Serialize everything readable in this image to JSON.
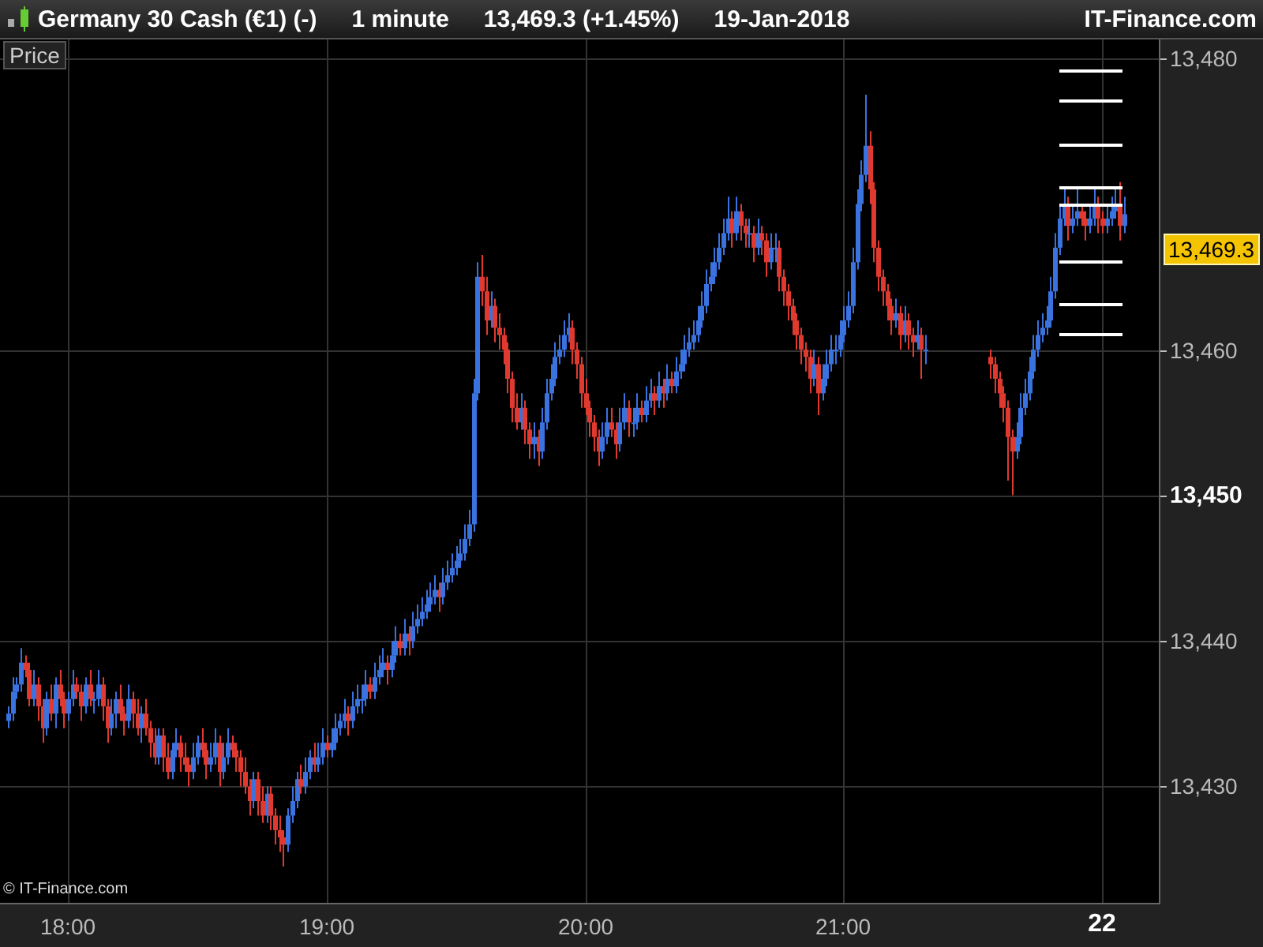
{
  "header": {
    "instrument": "Germany 30 Cash (€1) (-)",
    "interval": "1 minute",
    "quote": "13,469.3 (+1.45%)",
    "date": "19-Jan-2018",
    "brand": "IT-Finance.com"
  },
  "chart": {
    "series_label": "Price",
    "credit": "© IT-Finance.com",
    "last_price": "13,469.3",
    "tick_emphasis": {
      "x": [
        false,
        false,
        false,
        false,
        true
      ],
      "y": [
        false,
        false,
        true,
        false,
        false
      ]
    },
    "chart_data": {
      "type": "candlestick",
      "grid": true,
      "xlim": [
        17.7375,
        22.225
      ],
      "ylim": [
        13421.9,
        13481.3
      ],
      "xticks": [
        {
          "value": 18,
          "label": "18:00"
        },
        {
          "value": 19,
          "label": "19:00"
        },
        {
          "value": 20,
          "label": "20:00"
        },
        {
          "value": 21,
          "label": "21:00"
        },
        {
          "value": 22,
          "label": "22"
        }
      ],
      "yticks": [
        {
          "value": 13480,
          "label": "13,480"
        },
        {
          "value": 13460,
          "label": "13,460"
        },
        {
          "value": 13450,
          "label": "13,450"
        },
        {
          "value": 13440,
          "label": "13,440"
        },
        {
          "value": 13430,
          "label": "13,430"
        }
      ],
      "x": [
        17.7667,
        17.7833,
        17.8,
        17.8167,
        17.8333,
        17.85,
        17.8667,
        17.8833,
        17.9,
        17.9167,
        17.9333,
        17.95,
        17.9667,
        17.9833,
        18,
        18.0167,
        18.0333,
        18.05,
        18.0667,
        18.0833,
        18.1,
        18.1167,
        18.1333,
        18.15,
        18.1667,
        18.1833,
        18.2,
        18.2167,
        18.2333,
        18.25,
        18.2667,
        18.2833,
        18.3,
        18.3167,
        18.3333,
        18.35,
        18.3667,
        18.3833,
        18.4,
        18.4167,
        18.4333,
        18.45,
        18.4667,
        18.4833,
        18.5,
        18.5167,
        18.5333,
        18.55,
        18.5667,
        18.5833,
        18.6,
        18.6167,
        18.6333,
        18.65,
        18.6667,
        18.6833,
        18.7,
        18.7167,
        18.7333,
        18.75,
        18.7667,
        18.7833,
        18.8,
        18.8167,
        18.8333,
        18.85,
        18.8667,
        18.8833,
        18.9,
        18.9167,
        18.9333,
        18.95,
        18.9667,
        18.9833,
        19,
        19.0167,
        19.0333,
        19.05,
        19.0667,
        19.0833,
        19.1,
        19.1167,
        19.1333,
        19.15,
        19.1667,
        19.1833,
        19.2,
        19.2167,
        19.2333,
        19.25,
        19.2667,
        19.2833,
        19.3,
        19.3167,
        19.3333,
        19.35,
        19.3667,
        19.3833,
        19.4,
        19.4167,
        19.4333,
        19.45,
        19.4667,
        19.4833,
        19.5,
        19.5167,
        19.5333,
        19.55,
        19.5667,
        19.5833,
        19.6,
        19.6167,
        19.6333,
        19.65,
        19.6667,
        19.6833,
        19.7,
        19.7167,
        19.7333,
        19.75,
        19.7667,
        19.7833,
        19.8,
        19.8167,
        19.8333,
        19.85,
        19.8667,
        19.8833,
        19.9,
        19.9167,
        19.9333,
        19.95,
        19.9667,
        19.9833,
        20,
        20.0167,
        20.0333,
        20.05,
        20.0667,
        20.0833,
        20.1,
        20.1167,
        20.1333,
        20.15,
        20.1667,
        20.1833,
        20.2,
        20.2167,
        20.2333,
        20.25,
        20.2667,
        20.2833,
        20.3,
        20.3167,
        20.3333,
        20.35,
        20.3667,
        20.3833,
        20.4,
        20.4167,
        20.4333,
        20.45,
        20.4667,
        20.4833,
        20.5,
        20.5167,
        20.5333,
        20.55,
        20.5667,
        20.5833,
        20.6,
        20.6167,
        20.6333,
        20.65,
        20.6667,
        20.6833,
        20.7,
        20.7167,
        20.7333,
        20.75,
        20.7667,
        20.7833,
        20.8,
        20.8167,
        20.8333,
        20.85,
        20.8667,
        20.8833,
        20.9,
        20.9167,
        20.9333,
        20.95,
        20.9667,
        20.9833,
        21,
        21.0167,
        21.0333,
        21.05,
        21.0667,
        21.0833,
        21.1,
        21.1167,
        21.1333,
        21.15,
        21.1667,
        21.1833,
        21.2,
        21.2167,
        21.2333,
        21.25,
        21.2667,
        21.2833,
        21.3,
        21.3167,
        21.5667,
        21.5833,
        21.6,
        21.6167,
        21.6333,
        21.65,
        21.6667,
        21.6833,
        21.7,
        21.7167,
        21.7333,
        21.75,
        21.7667,
        21.7833,
        21.8,
        21.8167,
        21.8333,
        21.85,
        21.8667,
        21.8833,
        21.9,
        21.9167,
        21.9333,
        21.95,
        21.9667,
        21.9833,
        22,
        22.0167,
        22.0333,
        22.05,
        22.0667,
        22.0833
      ],
      "ohlc": [
        [
          13434.5,
          13435.5,
          13434,
          13435
        ],
        [
          13435,
          13437.5,
          13434.5,
          13436.5
        ],
        [
          13436.5,
          13437.5,
          13436,
          13437
        ],
        [
          13437,
          13439.5,
          13436.5,
          13438.5
        ],
        [
          13438.5,
          13439,
          13437.5,
          13438
        ],
        [
          13438,
          13438.5,
          13435.5,
          13436
        ],
        [
          13436,
          13438,
          13435.5,
          13437
        ],
        [
          13437,
          13437.5,
          13434.5,
          13435.5
        ],
        [
          13435.5,
          13436,
          13433,
          13434
        ],
        [
          13434,
          13436.5,
          13433.5,
          13436
        ],
        [
          13436,
          13437,
          13434.5,
          13435
        ],
        [
          13435,
          13437.5,
          13434,
          13437
        ],
        [
          13437,
          13438,
          13435.5,
          13436
        ],
        [
          13436,
          13436.5,
          13434,
          13435
        ],
        [
          13435,
          13436.5,
          13434.5,
          13436
        ],
        [
          13436,
          13438,
          13435.5,
          13437
        ],
        [
          13437,
          13437.5,
          13436,
          13436.5
        ],
        [
          13436.5,
          13437,
          13434.5,
          13435.5
        ],
        [
          13435.5,
          13437.5,
          13435,
          13437
        ],
        [
          13437,
          13438,
          13435.5,
          13436
        ],
        [
          13436,
          13436.5,
          13435,
          13436
        ],
        [
          13436,
          13438,
          13435.5,
          13437
        ],
        [
          13437,
          13437.5,
          13434.5,
          13435.5
        ],
        [
          13435.5,
          13436,
          13433,
          13434
        ],
        [
          13434,
          13436,
          13433.5,
          13435
        ],
        [
          13435,
          13436.5,
          13434,
          13436
        ],
        [
          13436,
          13437,
          13434.5,
          13435
        ],
        [
          13435,
          13435.5,
          13433.5,
          13434.5
        ],
        [
          13434.5,
          13437,
          13434,
          13436
        ],
        [
          13436,
          13436.5,
          13434,
          13435
        ],
        [
          13435,
          13436,
          13433.5,
          13434
        ],
        [
          13434,
          13435.5,
          13433,
          13435
        ],
        [
          13435,
          13436,
          13433.5,
          13434
        ],
        [
          13434,
          13434.5,
          13432,
          13433
        ],
        [
          13433,
          13434,
          13431.5,
          13432
        ],
        [
          13432,
          13434,
          13431.5,
          13433.5
        ],
        [
          13433.5,
          13434,
          13431,
          13432
        ],
        [
          13432,
          13433,
          13430.5,
          13431
        ],
        [
          13431,
          13433,
          13430.5,
          13432.5
        ],
        [
          13432.5,
          13434,
          13432,
          13433
        ],
        [
          13433,
          13433.5,
          13431,
          13432
        ],
        [
          13432,
          13433,
          13431,
          13431.5
        ],
        [
          13431.5,
          13432,
          13430,
          13431
        ],
        [
          13431,
          13433,
          13430.5,
          13432
        ],
        [
          13432,
          13433.5,
          13431.5,
          13433
        ],
        [
          13433,
          13434,
          13432,
          13432.5
        ],
        [
          13432.5,
          13433,
          13430.5,
          13431.5
        ],
        [
          13431.5,
          13433,
          13431,
          13432
        ],
        [
          13432,
          13434,
          13431.5,
          13433
        ],
        [
          13433,
          13433.5,
          13430,
          13431
        ],
        [
          13431,
          13433,
          13430.5,
          13432
        ],
        [
          13432,
          13434,
          13431.5,
          13433
        ],
        [
          13433,
          13433.5,
          13432,
          13432.5
        ],
        [
          13432.5,
          13433,
          13431,
          13432
        ],
        [
          13432,
          13432.5,
          13430,
          13431
        ],
        [
          13431,
          13432,
          13429.5,
          13430
        ],
        [
          13430,
          13430.5,
          13428,
          13429
        ],
        [
          13429,
          13431,
          13428.5,
          13430.5
        ],
        [
          13430.5,
          13431,
          13428,
          13429
        ],
        [
          13429,
          13430,
          13427.5,
          13428
        ],
        [
          13428,
          13430,
          13427.5,
          13429.5
        ],
        [
          13429.5,
          13430,
          13427,
          13428
        ],
        [
          13428,
          13428.5,
          13426,
          13427
        ],
        [
          13427,
          13428,
          13425.5,
          13426.5
        ],
        [
          13426.5,
          13427,
          13424.5,
          13426
        ],
        [
          13426,
          13428.5,
          13425.5,
          13428
        ],
        [
          13428,
          13430,
          13427.5,
          13429
        ],
        [
          13429,
          13431,
          13428.5,
          13430.5
        ],
        [
          13430.5,
          13431.5,
          13429.5,
          13430
        ],
        [
          13430,
          13432,
          13429.5,
          13431
        ],
        [
          13431,
          13432.5,
          13430.5,
          13432
        ],
        [
          13432,
          13433,
          13431,
          13431.5
        ],
        [
          13431.5,
          13433,
          13431,
          13432
        ],
        [
          13432,
          13434,
          13431.5,
          13433
        ],
        [
          13433,
          13433.5,
          13432,
          13432.5
        ],
        [
          13432.5,
          13434,
          13432,
          13433
        ],
        [
          13433,
          13435,
          13432.5,
          13434
        ],
        [
          13434,
          13435,
          13433.5,
          13434.5
        ],
        [
          13434.5,
          13436,
          13434,
          13435
        ],
        [
          13435,
          13435.5,
          13433.5,
          13434.5
        ],
        [
          13434.5,
          13436.5,
          13434,
          13435.5
        ],
        [
          13435.5,
          13437,
          13435,
          13436
        ],
        [
          13436,
          13437,
          13435,
          13436
        ],
        [
          13436,
          13438,
          13435.5,
          13437
        ],
        [
          13437,
          13437.5,
          13436,
          13436.5
        ],
        [
          13436.5,
          13438.5,
          13436,
          13437.5
        ],
        [
          13437.5,
          13439,
          13437,
          13438
        ],
        [
          13438,
          13439.5,
          13437.5,
          13438.5
        ],
        [
          13438.5,
          13439,
          13437,
          13438
        ],
        [
          13438,
          13440,
          13437.5,
          13439
        ],
        [
          13439,
          13441,
          13438.5,
          13440
        ],
        [
          13440,
          13440.5,
          13439,
          13439.5
        ],
        [
          13439.5,
          13441.5,
          13439,
          13440.5
        ],
        [
          13440.5,
          13441,
          13439,
          13440
        ],
        [
          13440,
          13442,
          13439.5,
          13441
        ],
        [
          13441,
          13442.5,
          13440.5,
          13441.5
        ],
        [
          13441.5,
          13443,
          13441,
          13442
        ],
        [
          13442,
          13443.5,
          13441.5,
          13442.5
        ],
        [
          13442.5,
          13444,
          13442,
          13443
        ],
        [
          13443,
          13444.5,
          13442.5,
          13443.5
        ],
        [
          13443.5,
          13444,
          13442,
          13443
        ],
        [
          13443,
          13445,
          13442.5,
          13444
        ],
        [
          13444,
          13445.5,
          13443.5,
          13444.5
        ],
        [
          13444.5,
          13446,
          13444,
          13445
        ],
        [
          13445,
          13446.5,
          13444.5,
          13445.5
        ],
        [
          13445.5,
          13447,
          13445,
          13446
        ],
        [
          13446,
          13448,
          13445.5,
          13447
        ],
        [
          13447,
          13449,
          13446.5,
          13448
        ],
        [
          13448,
          13458,
          13447.5,
          13457
        ],
        [
          13457,
          13466,
          13456.5,
          13465
        ],
        [
          13465,
          13466.5,
          13463,
          13464
        ],
        [
          13464,
          13465,
          13461,
          13462
        ],
        [
          13462,
          13464,
          13461.5,
          13463
        ],
        [
          13463,
          13463.5,
          13460.5,
          13461.5
        ],
        [
          13461.5,
          13462.5,
          13460,
          13461
        ],
        [
          13461,
          13461.5,
          13459,
          13460
        ],
        [
          13460,
          13460.5,
          13457,
          13458
        ],
        [
          13458,
          13458.5,
          13455,
          13456
        ],
        [
          13456,
          13457,
          13454.5,
          13455
        ],
        [
          13455,
          13457,
          13454.5,
          13456
        ],
        [
          13456,
          13456.5,
          13453.5,
          13454.5
        ],
        [
          13454.5,
          13455,
          13452.5,
          13453.5
        ],
        [
          13453.5,
          13455,
          13452.5,
          13454
        ],
        [
          13454,
          13454.5,
          13452,
          13453
        ],
        [
          13453,
          13456,
          13452.5,
          13455
        ],
        [
          13455,
          13458,
          13454.5,
          13457
        ],
        [
          13457,
          13459,
          13456.5,
          13458
        ],
        [
          13458,
          13460.5,
          13457.5,
          13459.5
        ],
        [
          13459.5,
          13461,
          13459,
          13460
        ],
        [
          13460,
          13462,
          13459.5,
          13461
        ],
        [
          13461,
          13462.5,
          13460.5,
          13461.5
        ],
        [
          13461.5,
          13462,
          13459,
          13460
        ],
        [
          13460,
          13460.5,
          13458,
          13459
        ],
        [
          13459,
          13459.5,
          13456,
          13457
        ],
        [
          13457,
          13458,
          13455.5,
          13456
        ],
        [
          13456,
          13456.5,
          13454,
          13455
        ],
        [
          13455,
          13455.5,
          13453,
          13454
        ],
        [
          13454,
          13454.5,
          13452,
          13453
        ],
        [
          13453,
          13455,
          13452.5,
          13454
        ],
        [
          13454,
          13456,
          13453.5,
          13455
        ],
        [
          13455,
          13456,
          13454,
          13454.5
        ],
        [
          13454.5,
          13455,
          13452.5,
          13453.5
        ],
        [
          13453.5,
          13456,
          13453,
          13455
        ],
        [
          13455,
          13457,
          13454.5,
          13456
        ],
        [
          13456,
          13456.5,
          13454,
          13455
        ],
        [
          13455,
          13456,
          13454,
          13455
        ],
        [
          13455,
          13457,
          13454.5,
          13456
        ],
        [
          13456,
          13456.5,
          13455,
          13455.5
        ],
        [
          13455.5,
          13457.5,
          13455,
          13456.5
        ],
        [
          13456.5,
          13458,
          13456,
          13457
        ],
        [
          13457,
          13457.5,
          13455.5,
          13456.5
        ],
        [
          13456.5,
          13458.5,
          13456,
          13457.5
        ],
        [
          13457.5,
          13458,
          13456,
          13457
        ],
        [
          13457,
          13459,
          13456.5,
          13458
        ],
        [
          13458,
          13458.5,
          13457,
          13457.5
        ],
        [
          13457.5,
          13459.5,
          13457,
          13458.5
        ],
        [
          13458.5,
          13460,
          13458,
          13459
        ],
        [
          13459,
          13461,
          13458.5,
          13460
        ],
        [
          13460,
          13461.5,
          13459.5,
          13460.5
        ],
        [
          13460.5,
          13462,
          13460,
          13461
        ],
        [
          13461,
          13463,
          13460.5,
          13462
        ],
        [
          13462,
          13464,
          13461.5,
          13463
        ],
        [
          13463,
          13465.5,
          13462.5,
          13464.5
        ],
        [
          13464.5,
          13466,
          13464,
          13465
        ],
        [
          13465,
          13467,
          13464.5,
          13466
        ],
        [
          13466,
          13468,
          13465.5,
          13467
        ],
        [
          13467,
          13469,
          13466.5,
          13468
        ],
        [
          13468,
          13470.5,
          13467.5,
          13469
        ],
        [
          13469,
          13469.5,
          13467,
          13468
        ],
        [
          13468,
          13470.5,
          13467.5,
          13469.5
        ],
        [
          13469.5,
          13470,
          13467.5,
          13468.5
        ],
        [
          13468.5,
          13469,
          13467,
          13468
        ],
        [
          13468,
          13469,
          13467,
          13468
        ],
        [
          13468,
          13468.5,
          13466,
          13467
        ],
        [
          13467,
          13469,
          13466.5,
          13468
        ],
        [
          13468,
          13468.5,
          13466.5,
          13467.5
        ],
        [
          13467.5,
          13468,
          13465,
          13466
        ],
        [
          13466,
          13468,
          13465.5,
          13467
        ],
        [
          13467,
          13468,
          13466,
          13467
        ],
        [
          13467,
          13467.5,
          13464,
          13465
        ],
        [
          13465,
          13465.5,
          13463,
          13464
        ],
        [
          13464,
          13464.5,
          13462,
          13463
        ],
        [
          13463,
          13463.5,
          13461,
          13462
        ],
        [
          13462,
          13462.5,
          13460,
          13461
        ],
        [
          13461,
          13461.5,
          13459,
          13460
        ],
        [
          13460,
          13460.5,
          13458.5,
          13459.5
        ],
        [
          13459.5,
          13460,
          13457,
          13458
        ],
        [
          13458,
          13460,
          13457.5,
          13459
        ],
        [
          13459,
          13459.5,
          13455.5,
          13457
        ],
        [
          13457,
          13459,
          13456.5,
          13458
        ],
        [
          13458,
          13460,
          13457.5,
          13459
        ],
        [
          13459,
          13461,
          13458.5,
          13460
        ],
        [
          13460,
          13461,
          13459,
          13460
        ],
        [
          13460,
          13462,
          13459.5,
          13461
        ],
        [
          13461,
          13463,
          13460.5,
          13462
        ],
        [
          13462,
          13464,
          13461.5,
          13463
        ],
        [
          13463,
          13467,
          13462.5,
          13466
        ],
        [
          13466,
          13471,
          13465.5,
          13470
        ],
        [
          13470,
          13473,
          13469.5,
          13472
        ],
        [
          13472,
          13477.5,
          13471.5,
          13474
        ],
        [
          13474,
          13475,
          13470,
          13471
        ],
        [
          13471,
          13471.5,
          13466,
          13467
        ],
        [
          13467,
          13467.5,
          13464,
          13465
        ],
        [
          13465,
          13465.5,
          13463,
          13464
        ],
        [
          13464,
          13464.5,
          13462,
          13463
        ],
        [
          13463,
          13463.5,
          13461,
          13462
        ],
        [
          13462,
          13463.5,
          13461.5,
          13462.5
        ],
        [
          13462.5,
          13463,
          13460,
          13461
        ],
        [
          13461,
          13463,
          13460.5,
          13462
        ],
        [
          13462,
          13462.5,
          13460,
          13461
        ],
        [
          13461,
          13461.5,
          13459.5,
          13460.5
        ],
        [
          13460.5,
          13462,
          13460,
          13461
        ],
        [
          13461,
          13461.5,
          13458,
          13460
        ],
        [
          13460,
          13461,
          13459,
          13460
        ],
        [
          13459.5,
          13460,
          13458,
          13459
        ],
        [
          13459,
          13459.5,
          13457,
          13458
        ],
        [
          13458,
          13458.5,
          13456,
          13457
        ],
        [
          13457,
          13457.5,
          13455,
          13456
        ],
        [
          13456,
          13456.5,
          13451,
          13454
        ],
        [
          13454,
          13454.5,
          13450,
          13453
        ],
        [
          13453,
          13455,
          13452.5,
          13454
        ],
        [
          13454,
          13457,
          13453.5,
          13456
        ],
        [
          13456,
          13458,
          13455.5,
          13457
        ],
        [
          13457,
          13459.5,
          13456.5,
          13458.5
        ],
        [
          13458.5,
          13461,
          13458,
          13460
        ],
        [
          13460,
          13462,
          13459.5,
          13461
        ],
        [
          13461,
          13462.5,
          13460.5,
          13461.5
        ],
        [
          13461.5,
          13463,
          13461,
          13462
        ],
        [
          13462,
          13465,
          13461.5,
          13464
        ],
        [
          13464,
          13468,
          13463.5,
          13467
        ],
        [
          13467,
          13470,
          13466.5,
          13469
        ],
        [
          13469,
          13471,
          13468.5,
          13470
        ],
        [
          13470,
          13470.5,
          13467.5,
          13468.5
        ],
        [
          13468.5,
          13470,
          13468,
          13469
        ],
        [
          13469,
          13471,
          13468.5,
          13469.5
        ],
        [
          13469.5,
          13470,
          13468.5,
          13469
        ],
        [
          13469,
          13469.5,
          13467.5,
          13468.5
        ],
        [
          13468.5,
          13470,
          13468,
          13469
        ],
        [
          13469,
          13471,
          13468.5,
          13470
        ],
        [
          13470,
          13470.5,
          13468,
          13469
        ],
        [
          13469,
          13469.5,
          13468,
          13468.5
        ],
        [
          13468.5,
          13470,
          13468,
          13469
        ],
        [
          13469,
          13470.5,
          13468.5,
          13469.5
        ],
        [
          13469.5,
          13471,
          13469,
          13470
        ],
        [
          13470,
          13471.5,
          13467.5,
          13468.5
        ],
        [
          13468.5,
          13470.5,
          13468,
          13469.3
        ]
      ]
    }
  }
}
